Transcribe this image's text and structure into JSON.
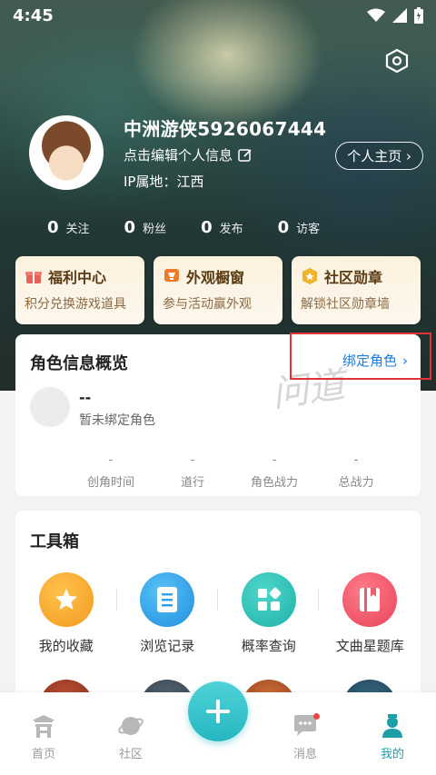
{
  "status_bar": {
    "time": "4:45"
  },
  "profile": {
    "username": "中洲游侠5926067444",
    "edit_info": "点击编辑个人信息",
    "ip_location": "IP属地：江西",
    "homepage_label": "个人主页",
    "stats": [
      {
        "value": "0",
        "label": "关注"
      },
      {
        "value": "0",
        "label": "粉丝"
      },
      {
        "value": "0",
        "label": "发布"
      },
      {
        "value": "0",
        "label": "访客"
      }
    ]
  },
  "cards": [
    {
      "title": "福利中心",
      "subtitle": "积分兑换游戏道具",
      "icon": "gift-icon",
      "color": "#e8615a"
    },
    {
      "title": "外观橱窗",
      "subtitle": "参与活动赢外观",
      "icon": "trophy-icon",
      "color": "#ef7a2a"
    },
    {
      "title": "社区勋章",
      "subtitle": "解锁社区勋章墙",
      "icon": "medal-icon",
      "color": "#f0b429"
    }
  ],
  "role": {
    "title": "角色信息概览",
    "bind_label": "绑定角色",
    "name": "--",
    "status": "暂未绑定角色",
    "watermark": "问道",
    "stats": [
      {
        "value": "-",
        "label": "创角时间"
      },
      {
        "value": "-",
        "label": "道行"
      },
      {
        "value": "-",
        "label": "角色战力"
      },
      {
        "value": "-",
        "label": "总战力"
      }
    ]
  },
  "toolbox": {
    "title": "工具箱",
    "tools": [
      {
        "label": "我的收藏",
        "icon": "star-icon",
        "color": "#f6a32b"
      },
      {
        "label": "浏览记录",
        "icon": "document-icon",
        "color": "#2fa3e8"
      },
      {
        "label": "概率查询",
        "icon": "grid-icon",
        "color": "#29c2b8"
      },
      {
        "label": "文曲星题库",
        "icon": "book-icon",
        "color": "#f05a6a"
      }
    ]
  },
  "bottom_nav": {
    "items": [
      {
        "label": "首页",
        "icon": "home-gate-icon"
      },
      {
        "label": "社区",
        "icon": "planet-icon"
      },
      {
        "label": "消息",
        "icon": "chat-icon"
      },
      {
        "label": "我的",
        "icon": "user-icon"
      }
    ],
    "active": "我的",
    "accent": "#1e9fa8"
  }
}
